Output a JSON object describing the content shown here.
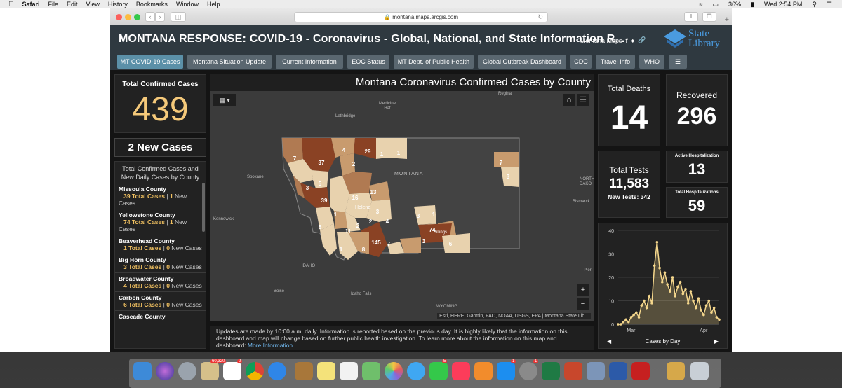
{
  "menubar": {
    "app": "Safari",
    "items": [
      "File",
      "Edit",
      "View",
      "History",
      "Bookmarks",
      "Window",
      "Help"
    ],
    "battery": "36%",
    "clock": "Wed 2:54 PM"
  },
  "browser": {
    "url": "montana.maps.arcgis.com"
  },
  "header": {
    "title": "MONTANA RESPONSE: COVID-19 - Coronavirus - Global, National, and State Information R...",
    "maps_link": "Montana Maps",
    "logo_line1": "State",
    "logo_line2": "Library"
  },
  "tabs": [
    "MT COVID-19 Cases",
    "Montana Situation Update",
    "Current Information",
    "EOC Status",
    "MT Dept. of Public Health",
    "Global Outbreak Dashboard",
    "CDC",
    "Travel Info",
    "WHO"
  ],
  "stats": {
    "confirmed_label": "Total Confirmed Cases",
    "confirmed_value": "439",
    "new_cases": "2 New Cases",
    "deaths_label": "Total Deaths",
    "deaths_value": "14",
    "recovered_label": "Recovered",
    "recovered_value": "296",
    "tests_label": "Total Tests",
    "tests_value": "11,583",
    "new_tests": "New Tests: 342",
    "active_hosp_label": "Active Hospitalization",
    "active_hosp_value": "13",
    "total_hosp_label": "Total Hospitalizations",
    "total_hosp_value": "59"
  },
  "county_list": {
    "heading": "Total Confirmed Cases and New Daily Cases by County",
    "total_word": "Total Cases",
    "new_word": "New",
    "cases_word": "Cases",
    "items": [
      {
        "county": "Missoula County",
        "total": "39",
        "new": "1"
      },
      {
        "county": "Yellowstone County",
        "total": "74",
        "new": "1"
      },
      {
        "county": "Beaverhead County",
        "total": "1",
        "new": "0"
      },
      {
        "county": "Big Horn County",
        "total": "3",
        "new": "0"
      },
      {
        "county": "Broadwater County",
        "total": "4",
        "new": "0"
      },
      {
        "county": "Carbon County",
        "total": "6",
        "new": "0"
      },
      {
        "county": "Cascade County",
        "total": "",
        "new": ""
      }
    ]
  },
  "map": {
    "title": "Montana Coronavirus Confirmed Cases by County",
    "places": [
      "Regina",
      "Medicine Hat",
      "Lethbridge",
      "Spokane",
      "Kennewick",
      "Boise",
      "Idaho Falls",
      "IDAHO",
      "WYOMING",
      "Bismarck",
      "NORTH DAKO",
      "MONTANA",
      "Helena",
      "Billings",
      "Pier",
      "Helena"
    ],
    "attribution": "Esri, HERE, Garmin, FAO, NOAA, USGS, EPA | Montana State Lib...",
    "zoom_in": "+",
    "zoom_out": "−",
    "labels": [
      "7",
      "37",
      "4",
      "29",
      "1",
      "1",
      "7",
      "2",
      "5",
      "3",
      "39",
      "16",
      "13",
      "1",
      "2",
      "3",
      "3",
      "1",
      "5",
      "11",
      "2",
      "4",
      "145",
      "7",
      "74",
      "3",
      "6",
      "1",
      "8",
      "3"
    ]
  },
  "info": {
    "text": "Updates are made by 10:00 a.m. daily. Information is reported based on the previous day. It is highly likely that the information on this dashboard and map will change based on further public health investigation.  To learn more about the information on this map and dashboard: ",
    "link": "More Information."
  },
  "chart_data": {
    "type": "line",
    "title": "",
    "xlabel": "Cases by Day",
    "ylabel": "",
    "ylim": [
      0,
      40
    ],
    "yticks": [
      0,
      10,
      20,
      30,
      40
    ],
    "xtick_labels": [
      "Mar",
      "Apr"
    ],
    "grid": true,
    "values": [
      0,
      0,
      1,
      2,
      1,
      3,
      4,
      5,
      3,
      8,
      10,
      7,
      12,
      9,
      25,
      35,
      24,
      18,
      22,
      17,
      14,
      20,
      12,
      16,
      18,
      13,
      15,
      9,
      14,
      10,
      7,
      11,
      6,
      4,
      8,
      10,
      5,
      7,
      3,
      2
    ]
  },
  "dock": {
    "badges": [
      "60,320",
      "2",
      "5",
      "1",
      "1"
    ]
  }
}
